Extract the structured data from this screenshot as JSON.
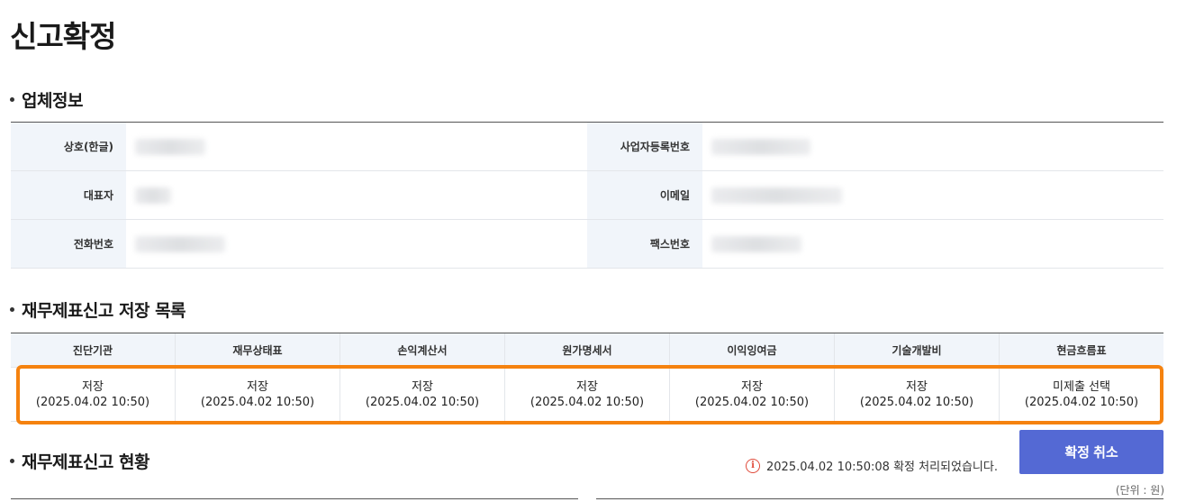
{
  "page": {
    "title": "신고확정"
  },
  "company_section": {
    "title": "업체정보",
    "rows": [
      {
        "left_label": "상호(한글)",
        "right_label": "사업자등록번호"
      },
      {
        "left_label": "대표자",
        "right_label": "이메일"
      },
      {
        "left_label": "전화번호",
        "right_label": "팩스번호"
      }
    ]
  },
  "save_list_section": {
    "title": "재무제표신고 저장 목록",
    "columns": [
      "진단기관",
      "재무상태표",
      "손익계산서",
      "원가명세서",
      "이익잉여금",
      "기술개발비",
      "현금흐름표"
    ],
    "row": [
      {
        "status": "저장",
        "time": "(2025.04.02 10:50)"
      },
      {
        "status": "저장",
        "time": "(2025.04.02 10:50)"
      },
      {
        "status": "저장",
        "time": "(2025.04.02 10:50)"
      },
      {
        "status": "저장",
        "time": "(2025.04.02 10:50)"
      },
      {
        "status": "저장",
        "time": "(2025.04.02 10:50)"
      },
      {
        "status": "저장",
        "time": "(2025.04.02 10:50)"
      },
      {
        "status": "미제출 선택",
        "time": "(2025.04.02 10:50)"
      }
    ]
  },
  "status_section": {
    "title": "재무제표신고 현황",
    "confirm_message": "2025.04.02 10:50:08 확정 처리되었습니다.",
    "cancel_button": "확정 취소",
    "unit_note": "(단위 : 원)"
  },
  "colors": {
    "accent_button": "#5469d4",
    "highlight": "#f5820f",
    "header_bg": "#f1f5fa",
    "info_icon": "#e04a3a"
  },
  "icons": {
    "info": "info-icon"
  }
}
